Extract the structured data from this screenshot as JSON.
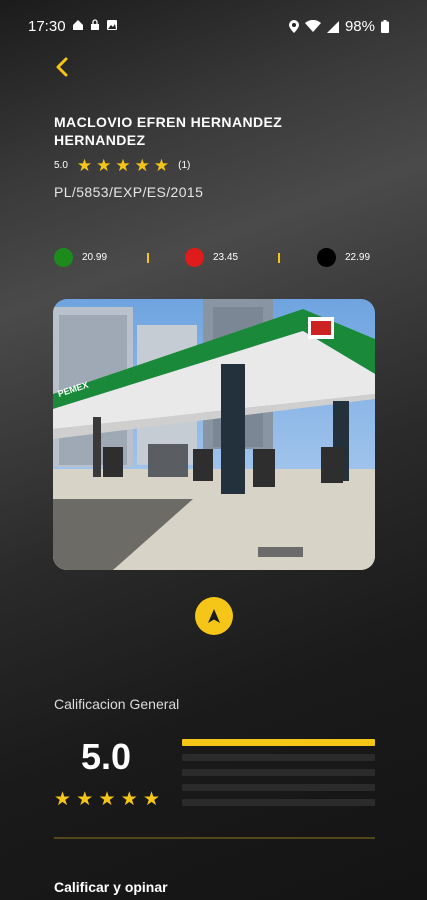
{
  "status_bar": {
    "time": "17:30",
    "battery": "98%"
  },
  "station": {
    "name": "MACLOVIO EFREN HERNANDEZ HERNANDEZ",
    "rating": "5.0",
    "reviews": "(1)",
    "permit": "PL/5853/EXP/ES/2015"
  },
  "prices": [
    {
      "color": "#1e8a1e",
      "value": "20.99"
    },
    {
      "color": "#e01b1b",
      "value": "23.45"
    },
    {
      "color": "#000000",
      "value": "22.99"
    }
  ],
  "photo": {
    "brand_text": "PEMEX"
  },
  "overall": {
    "label": "Calificacion General",
    "score": "5.0",
    "bars": [
      1.0,
      0,
      0,
      0,
      0
    ]
  },
  "rate_section": {
    "label": "Calificar y opinar"
  },
  "colors": {
    "accent": "#f5c518"
  }
}
